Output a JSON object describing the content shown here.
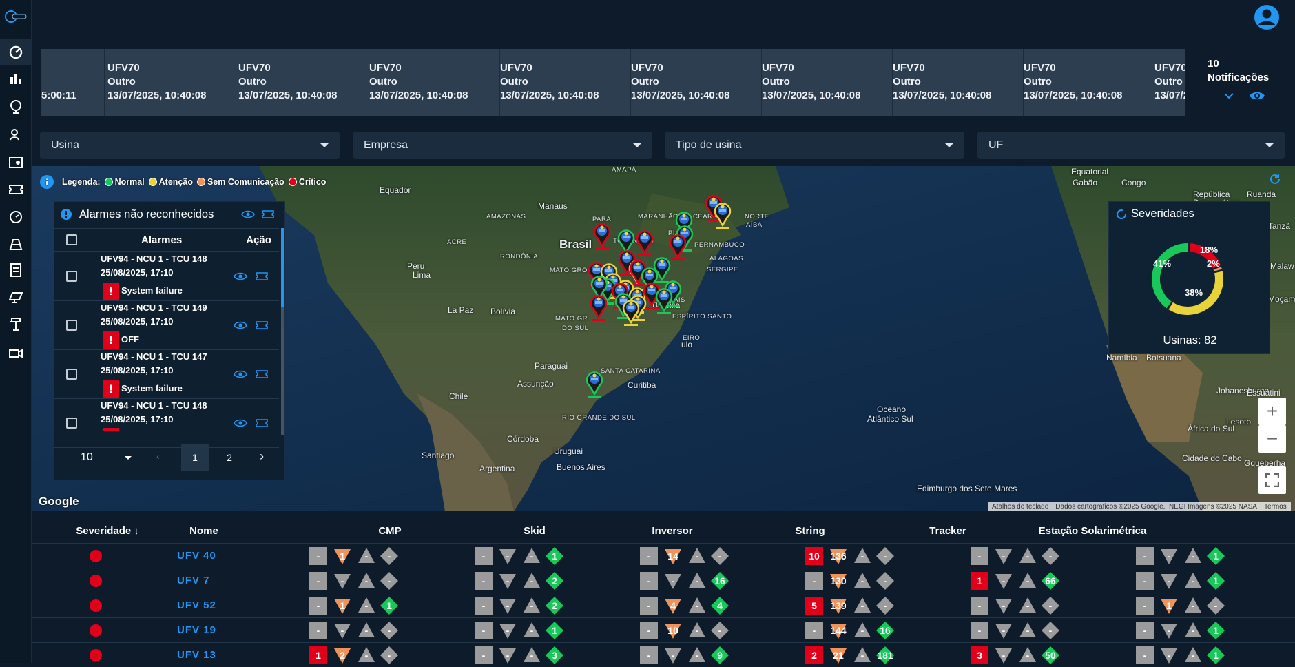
{
  "colors": {
    "normal": "#18c95a",
    "atencao": "#e8d43a",
    "sem_comunicacao": "#f0935a",
    "critico": "#e0001a",
    "accent": "#2196f3"
  },
  "nav": [
    "dashboard-icon",
    "bar-chart-icon",
    "globe-icon",
    "users-icon",
    "settings-panel-icon",
    "ticket-icon",
    "gauge-icon",
    "solar-plant-icon",
    "inverter-icon",
    "solar-panel-icon",
    "tracker-icon",
    "camera-icon"
  ],
  "ticker": {
    "first_partial": "5:00:11",
    "cards": [
      {
        "name": "UFV70",
        "type": "Outro",
        "time": "13/07/2025, 10:40:08"
      },
      {
        "name": "UFV70",
        "type": "Outro",
        "time": "13/07/2025, 10:40:08"
      },
      {
        "name": "UFV70",
        "type": "Outro",
        "time": "13/07/2025, 10:40:08"
      },
      {
        "name": "UFV70",
        "type": "Outro",
        "time": "13/07/2025, 10:40:08"
      },
      {
        "name": "UFV70",
        "type": "Outro",
        "time": "13/07/2025, 10:40:08"
      },
      {
        "name": "UFV70",
        "type": "Outro",
        "time": "13/07/2025, 10:40:08"
      },
      {
        "name": "UFV70",
        "type": "Outro",
        "time": "13/07/2025, 10:40:08"
      },
      {
        "name": "UFV70",
        "type": "Outro",
        "time": "13/07/2025, 10:40:08"
      },
      {
        "name": "UFV70",
        "type": "Outro",
        "time": "13/07/2"
      }
    ]
  },
  "notifications": {
    "count": "10",
    "label": "Notificações"
  },
  "filters": {
    "usina": "Usina",
    "empresa": "Empresa",
    "tipo": "Tipo de usina",
    "uf": "UF"
  },
  "legend": {
    "title": "Legenda:",
    "normal": "Normal",
    "atencao": "Atenção",
    "sem_comunicacao": "Sem Comunicação",
    "critico": "Crítico"
  },
  "map_labels": [
    "Equador",
    "Peru",
    "Lima",
    "Bolívia",
    "La Paz",
    "Chile",
    "Paraguai",
    "Assunção",
    "Uruguai",
    "Buenos Aires",
    "Argentina",
    "Santiago",
    "Córdoba",
    "Brasil",
    "Manaus",
    "Brasília",
    "Curitiba",
    "Equatorial",
    "Gabão",
    "Congo",
    "República",
    "Democrática",
    "Ruanda",
    "Tanzâ",
    "Malaw",
    "Moçam",
    "Namíbia",
    "Botsuana",
    "Johanesburgo",
    "Essuatini",
    "Lesoto",
    "África do Sul",
    "Cidade do Cabo",
    "Gqueberha",
    "Oceano",
    "Atlântico Sul",
    "Edimburgo dos Sete Mares",
    "AMAZONAS",
    "PARÁ",
    "MARANHÃO",
    "CEARÁ",
    "PIAUÍ",
    "TOCANTINS",
    "PERNAMBUCO",
    "ALAGOAS",
    "SERGIPE",
    "RONDÔNIA",
    "ACRE",
    "MATO GROSSO",
    "GERAIS",
    "ESPÍRITO SANTO",
    "MATO GR",
    "DO SUL",
    "EIRO",
    "SANTA CATARINA",
    "RIO GRANDE DO SUL",
    "NORTE",
    "AÍBA",
    "AMAPÁ",
    "ulo"
  ],
  "attribution": {
    "shortcuts": "Atalhos do teclado",
    "data": "Dados cartográficos ©2025 Google, INEGI Imagens ©2025 NASA",
    "terms": "Termos",
    "google": "Google"
  },
  "alarms": {
    "title": "Alarmes não reconhecidos",
    "col_alarms": "Alarmes",
    "col_action": "Ação",
    "rows": [
      {
        "device": "UFV94 - NCU 1 - TCU 148",
        "time": "25/08/2025, 17:10",
        "msg": "System failure"
      },
      {
        "device": "UFV94 - NCU 1 - TCU 149",
        "time": "25/08/2025, 17:10",
        "msg": "OFF"
      },
      {
        "device": "UFV94 - NCU 1 - TCU 147",
        "time": "25/08/2025, 17:10",
        "msg": "System failure"
      },
      {
        "device": "UFV94 - NCU 1 - TCU 148",
        "time": "25/08/2025, 17:10",
        "msg": ""
      }
    ],
    "page_size": "10",
    "pages": [
      "1",
      "2"
    ],
    "current_page": "1"
  },
  "severity": {
    "title": "Severidades",
    "total": "Usinas: 82",
    "slices": [
      {
        "label": "18%",
        "value": 18,
        "color": "#e0001a"
      },
      {
        "label": "2%",
        "value": 2,
        "color": "#f0935a"
      },
      {
        "label": "38%",
        "value": 38,
        "color": "#e8d43a"
      },
      {
        "label": "41%",
        "value": 41,
        "color": "#18c95a"
      }
    ]
  },
  "zoom": {
    "in": "+",
    "out": "−"
  },
  "table": {
    "headers": [
      "Severidade",
      "Nome",
      "CMP",
      "Skid",
      "Inversor",
      "String",
      "Tracker",
      "Estação Solarimétrica"
    ],
    "rows": [
      {
        "name": "UFV 40",
        "groups": [
          [
            "-",
            "1",
            "",
            ""
          ],
          [
            "-",
            "",
            "",
            "1"
          ],
          [
            "-",
            "14",
            "",
            ""
          ],
          [
            "10",
            "136",
            "",
            ""
          ],
          [
            "-",
            "",
            "",
            ""
          ],
          [
            "-",
            "",
            "",
            "1"
          ]
        ]
      },
      {
        "name": "UFV 7",
        "groups": [
          [
            "-",
            "",
            "",
            ""
          ],
          [
            "-",
            "",
            "",
            "2"
          ],
          [
            "-",
            "",
            "",
            "16"
          ],
          [
            "-",
            "130",
            "",
            ""
          ],
          [
            "1",
            "",
            "",
            "66"
          ],
          [
            "-",
            "",
            "",
            "1"
          ]
        ]
      },
      {
        "name": "UFV 52",
        "groups": [
          [
            "-",
            "1",
            "",
            "1"
          ],
          [
            "-",
            "",
            "",
            "2"
          ],
          [
            "-",
            "4",
            "",
            "4"
          ],
          [
            "5",
            "139",
            "",
            ""
          ],
          [
            "-",
            "",
            "",
            ""
          ],
          [
            "-",
            "1",
            "",
            ""
          ]
        ]
      },
      {
        "name": "UFV 19",
        "groups": [
          [
            "-",
            "",
            "",
            ""
          ],
          [
            "-",
            "",
            "",
            "1"
          ],
          [
            "-",
            "10",
            "",
            ""
          ],
          [
            "-",
            "144",
            "",
            "16"
          ],
          [
            "-",
            "",
            "",
            ""
          ],
          [
            "-",
            "",
            "",
            "1"
          ]
        ]
      },
      {
        "name": "UFV 13",
        "groups": [
          [
            "1",
            "2",
            "",
            ""
          ],
          [
            "-",
            "",
            "",
            "3"
          ],
          [
            "-",
            "",
            "",
            "9"
          ],
          [
            "2",
            "21",
            "",
            "181"
          ],
          [
            "3",
            "",
            "",
            "50"
          ],
          [
            "-",
            "",
            "",
            "1"
          ]
        ]
      }
    ]
  }
}
